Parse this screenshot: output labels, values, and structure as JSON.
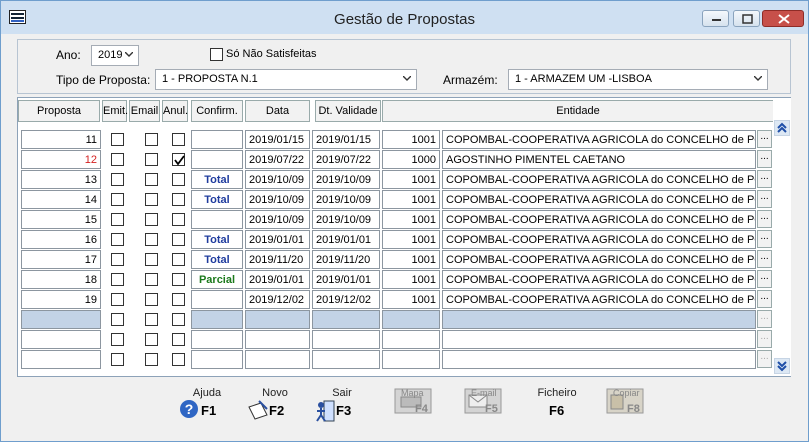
{
  "window": {
    "title": "Gestão de Propostas"
  },
  "filters": {
    "ano_label": "Ano:",
    "ano_value": "2019",
    "so_nao_satisfeitas_label": "Só Não Satisfeitas",
    "tipo_label": "Tipo de Proposta:",
    "tipo_value": "1 - PROPOSTA N.1",
    "armazem_label": "Armazém:",
    "armazem_value": "1 - ARMAZEM UM -LISBOA"
  },
  "table": {
    "headers": [
      "Proposta",
      "Emit.",
      "Email",
      "Anul.",
      "Confirm.",
      "Data",
      "Dt. Validade",
      "Entidade"
    ],
    "rows": [
      {
        "proposta": "11",
        "emit": false,
        "email": false,
        "anul": false,
        "confirm": "",
        "data": "2019/01/15",
        "validade": "2019/01/15",
        "ent_num": "1001",
        "entidade": "COPOMBAL-COOPERATIVA AGRICOLA  do CONCELHO de POMBAL",
        "confirm_color": "#1f3c9e"
      },
      {
        "proposta": "12",
        "emit": false,
        "email": false,
        "anul": true,
        "confirm": "",
        "data": "2019/07/22",
        "validade": "2019/07/22",
        "ent_num": "1000",
        "entidade": "AGOSTINHO PIMENTEL CAETANO",
        "confirm_color": "#1f3c9e"
      },
      {
        "proposta": "13",
        "emit": false,
        "email": false,
        "anul": false,
        "confirm": "Total",
        "data": "2019/10/09",
        "validade": "2019/10/09",
        "ent_num": "1001",
        "entidade": "COPOMBAL-COOPERATIVA AGRICOLA  do CONCELHO de POMBAL",
        "confirm_color": "#1f3c9e"
      },
      {
        "proposta": "14",
        "emit": false,
        "email": false,
        "anul": false,
        "confirm": "Total",
        "data": "2019/10/09",
        "validade": "2019/10/09",
        "ent_num": "1001",
        "entidade": "COPOMBAL-COOPERATIVA AGRICOLA  do CONCELHO de POMBAL",
        "confirm_color": "#1f3c9e"
      },
      {
        "proposta": "15",
        "emit": false,
        "email": false,
        "anul": false,
        "confirm": "",
        "data": "2019/10/09",
        "validade": "2019/10/09",
        "ent_num": "1001",
        "entidade": "COPOMBAL-COOPERATIVA AGRICOLA  do CONCELHO de POMBAL",
        "confirm_color": "#1f3c9e"
      },
      {
        "proposta": "16",
        "emit": false,
        "email": false,
        "anul": false,
        "confirm": "Total",
        "data": "2019/01/01",
        "validade": "2019/01/01",
        "ent_num": "1001",
        "entidade": "COPOMBAL-COOPERATIVA AGRICOLA  do CONCELHO de POMBAL",
        "confirm_color": "#1f3c9e"
      },
      {
        "proposta": "17",
        "emit": false,
        "email": false,
        "anul": false,
        "confirm": "Total",
        "data": "2019/11/20",
        "validade": "2019/11/20",
        "ent_num": "1001",
        "entidade": "COPOMBAL-COOPERATIVA AGRICOLA  do CONCELHO de POMBAL",
        "confirm_color": "#1f3c9e"
      },
      {
        "proposta": "18",
        "emit": false,
        "email": false,
        "anul": false,
        "confirm": "Parcial",
        "data": "2019/01/01",
        "validade": "2019/01/01",
        "ent_num": "1001",
        "entidade": "COPOMBAL-COOPERATIVA AGRICOLA  do CONCELHO de POMBAL",
        "confirm_color": "#1c7a1c"
      },
      {
        "proposta": "19",
        "emit": false,
        "email": false,
        "anul": false,
        "confirm": "",
        "data": "2019/12/02",
        "validade": "2019/12/02",
        "ent_num": "1001",
        "entidade": "COPOMBAL-COOPERATIVA AGRICOLA  do CONCELHO de POMBAL",
        "confirm_color": "#1f3c9e"
      }
    ],
    "empty_rows": 3,
    "ellipsis": "..."
  },
  "function_keys": [
    {
      "label": "Ajuda",
      "key": "F1",
      "icon": "help-icon",
      "enabled": true
    },
    {
      "label": "Novo",
      "key": "F2",
      "icon": "new-document-icon",
      "enabled": true
    },
    {
      "label": "Sair",
      "key": "F3",
      "icon": "exit-icon",
      "enabled": true
    },
    {
      "label": "Mapa",
      "key": "F4",
      "icon": "printer-icon",
      "enabled": false
    },
    {
      "label": "E-mail",
      "key": "F5",
      "icon": "email-icon",
      "enabled": false
    },
    {
      "label": "Ficheiro",
      "key": "F6",
      "icon": "file-icon",
      "enabled": true
    },
    {
      "label": "Copiar",
      "key": "F8",
      "icon": "copy-icon",
      "enabled": false
    }
  ]
}
